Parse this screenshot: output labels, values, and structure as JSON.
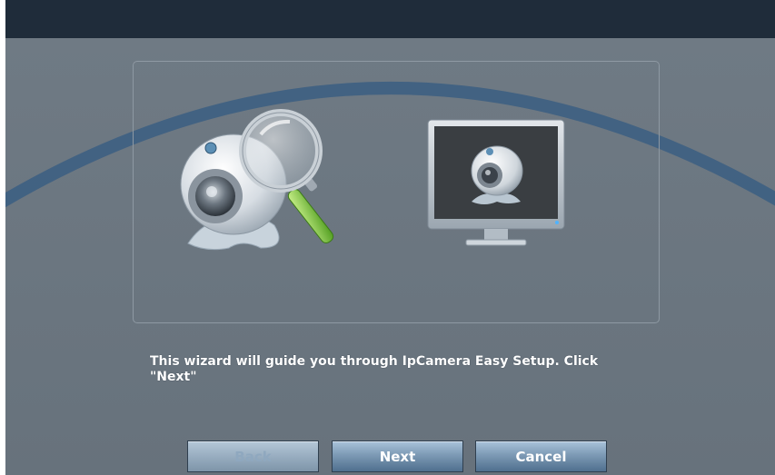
{
  "window": {
    "title": ""
  },
  "wizard": {
    "message_line1": "This wizard will guide you through IpCamera Easy Setup. Click",
    "message_line2": "\"Next\""
  },
  "buttons": {
    "back_label": "Back",
    "back_enabled": false,
    "next_label": "Next",
    "cancel_label": "Cancel"
  },
  "icons": {
    "left": "webcam-search-icon",
    "right": "monitor-webcam-icon"
  },
  "colors": {
    "title_bar": "#1f2c3a",
    "background": "#6b7680",
    "arc": "#3d5f82",
    "button_top": "#a9c3da",
    "button_bottom": "#4f6f8e"
  }
}
